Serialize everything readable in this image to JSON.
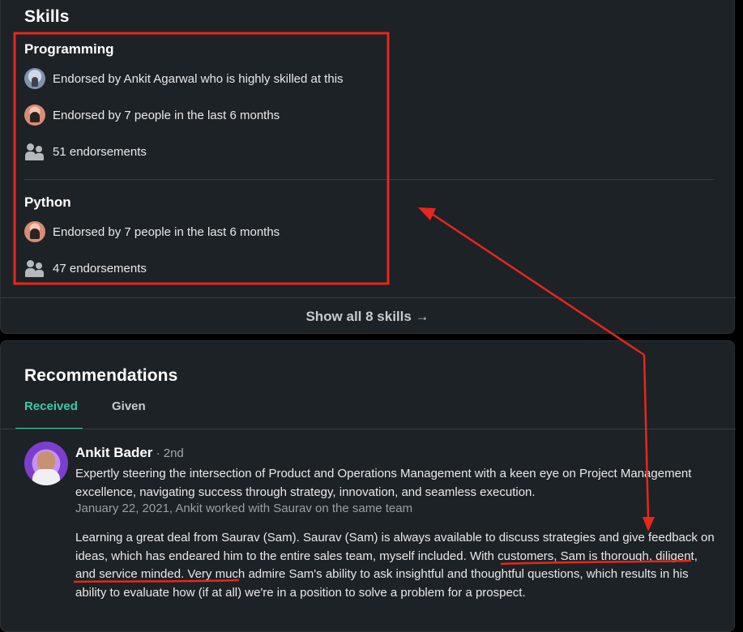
{
  "skills": {
    "heading": "Skills",
    "items": [
      {
        "title": "Programming",
        "rows": [
          {
            "icon": "avatar",
            "text": "Endorsed by Ankit Agarwal who is highly skilled at this"
          },
          {
            "icon": "avatar",
            "text": "Endorsed by 7 people in the last 6 months"
          },
          {
            "icon": "people-icon",
            "text": "51 endorsements"
          }
        ]
      },
      {
        "title": "Python",
        "rows": [
          {
            "icon": "avatar",
            "text": "Endorsed by 7 people in the last 6 months"
          },
          {
            "icon": "people-icon",
            "text": "47 endorsements"
          }
        ]
      }
    ],
    "show_all_label": "Show all 8 skills →"
  },
  "recommendations": {
    "heading": "Recommendations",
    "tabs": [
      {
        "label": "Received",
        "active": true
      },
      {
        "label": "Given",
        "active": false
      }
    ],
    "items": [
      {
        "name": "Ankit Bader",
        "degree": " · 2nd",
        "headline": "Expertly steering the intersection of Product and Operations Management with a keen eye on Project Management excellence, navigating success through strategy, innovation, and seamless execution.",
        "meta": "January 22, 2021, Ankit worked with Saurav on the same team",
        "text_before": "Learning a great deal from Saurav (Sam). Saurav (Sam) is always available to discuss strategies and give feedback on ideas, which has endeared him to the entire sales team, myself included. ",
        "text_highlight": "With customers, Sam is thorough, diligent, and service minded.",
        "text_after": " Very much admire Sam's ability to ask insightful and thoughtful questions, which results in his ability to evaluate how (if at all) we're in a position to solve a problem for a prospect."
      }
    ]
  },
  "colors": {
    "page_bg": "#000000",
    "card_bg": "#1d2226",
    "accent_tab": "#3ec9a7",
    "annotation_red": "#e8261b"
  }
}
